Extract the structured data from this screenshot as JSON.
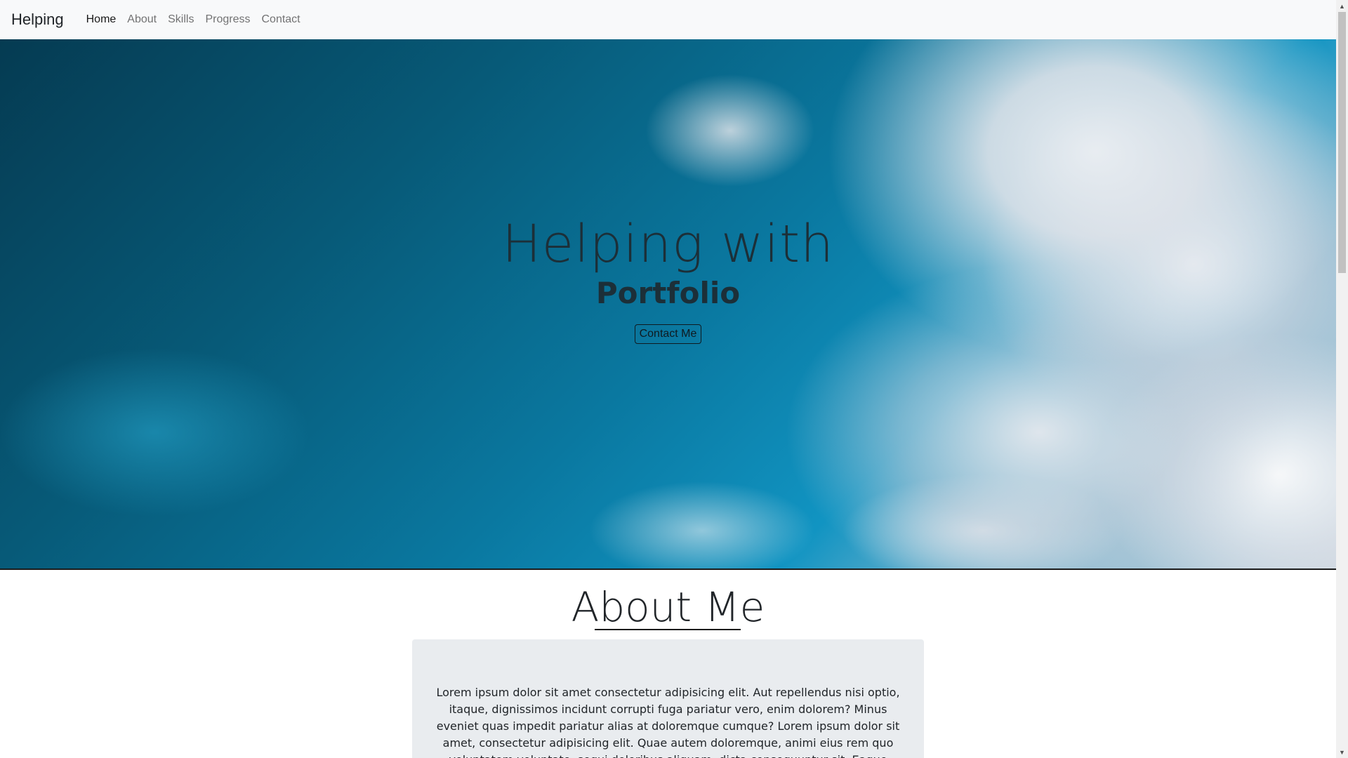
{
  "navbar": {
    "brand": "Helping",
    "links": [
      {
        "label": "Home",
        "active": true
      },
      {
        "label": "About",
        "active": false
      },
      {
        "label": "Skills",
        "active": false
      },
      {
        "label": "Progress",
        "active": false
      },
      {
        "label": "Contact",
        "active": false
      }
    ]
  },
  "hero": {
    "title": "Helping with",
    "subtitle": "Portfolio",
    "button_label": "Contact Me"
  },
  "about": {
    "heading": "About Me",
    "text": "Lorem ipsum dolor sit amet consectetur adipisicing elit. Aut repellendus nisi optio, itaque, dignissimos incidunt corrupti fuga pariatur vero, enim dolorem? Minus eveniet quas impedit pariatur alias at doloremque cumque? Lorem ipsum dolor sit amet, consectetur adipisicing elit. Quae autem doloremque, animi eius rem quo voluptatem voluptate, sequi doloribus aliquam, dicta consequuntur sit. Eaque necessitatibus voluptatibus suscipit corporis ipsam odio!"
  },
  "scrollbar": {
    "up_icon": "triangle-up-icon",
    "down_icon": "triangle-down-icon"
  },
  "colors": {
    "navbar_bg": "#f8f9fa",
    "about_card_bg": "#e9ecef",
    "text": "#212529"
  }
}
